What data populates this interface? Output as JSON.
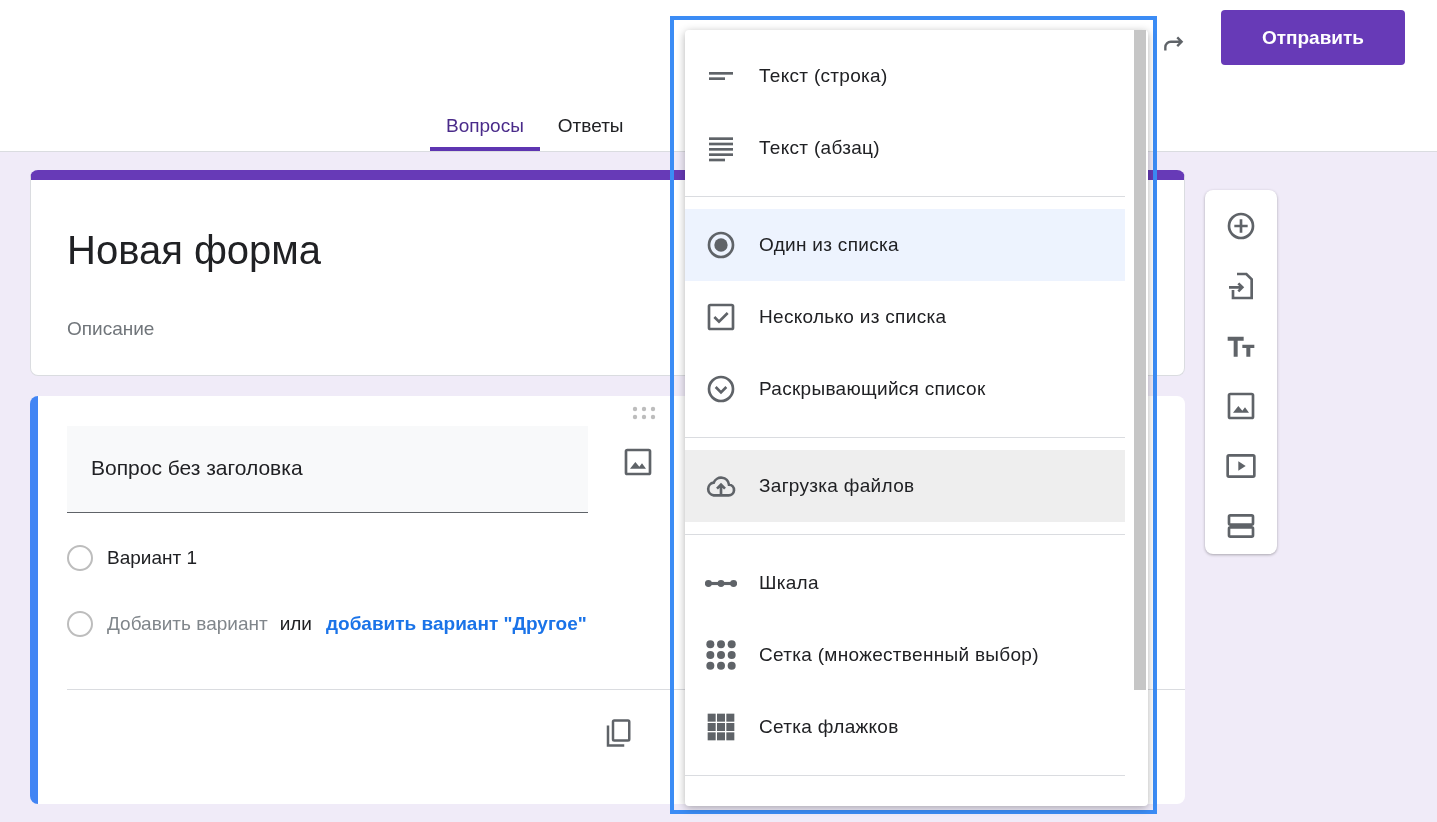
{
  "header": {
    "send_button": "Отправить"
  },
  "tabs": [
    {
      "label": "Вопросы",
      "selected": true
    },
    {
      "label": "Ответы",
      "selected": false
    }
  ],
  "form": {
    "title": "Новая форма",
    "description_placeholder": "Описание"
  },
  "question": {
    "title": "Вопрос без заголовка",
    "options": [
      {
        "label": "Вариант 1",
        "checked": false
      }
    ],
    "add_option_checked": false,
    "add_option": "Добавить вариант",
    "or": "или",
    "add_other": "добавить вариант \"Другое\""
  },
  "type_menu": {
    "groups": [
      {
        "items": [
          {
            "kind": "short",
            "label": "Текст (строка)",
            "selected": false,
            "hovered": false
          },
          {
            "kind": "paragraph",
            "label": "Текст (абзац)",
            "selected": false,
            "hovered": false
          }
        ]
      },
      {
        "items": [
          {
            "kind": "radio",
            "label": "Один из списка",
            "selected": true,
            "hovered": false
          },
          {
            "kind": "checkbox",
            "label": "Несколько из списка",
            "selected": false,
            "hovered": false
          },
          {
            "kind": "dropdown",
            "label": "Раскрывающийся список",
            "selected": false,
            "hovered": false
          }
        ]
      },
      {
        "items": [
          {
            "kind": "upload",
            "label": "Загрузка файлов",
            "selected": false,
            "hovered": true
          }
        ]
      },
      {
        "items": [
          {
            "kind": "scale",
            "label": "Шкала",
            "selected": false,
            "hovered": false
          },
          {
            "kind": "grid",
            "label": "Сетка (множественный выбор)",
            "selected": false,
            "hovered": false
          },
          {
            "kind": "checkgrid",
            "label": "Сетка флажков",
            "selected": false,
            "hovered": false
          }
        ]
      }
    ]
  },
  "side_toolbar": [
    {
      "kind": "add"
    },
    {
      "kind": "import"
    },
    {
      "kind": "text"
    },
    {
      "kind": "image"
    },
    {
      "kind": "video"
    },
    {
      "kind": "section"
    }
  ]
}
